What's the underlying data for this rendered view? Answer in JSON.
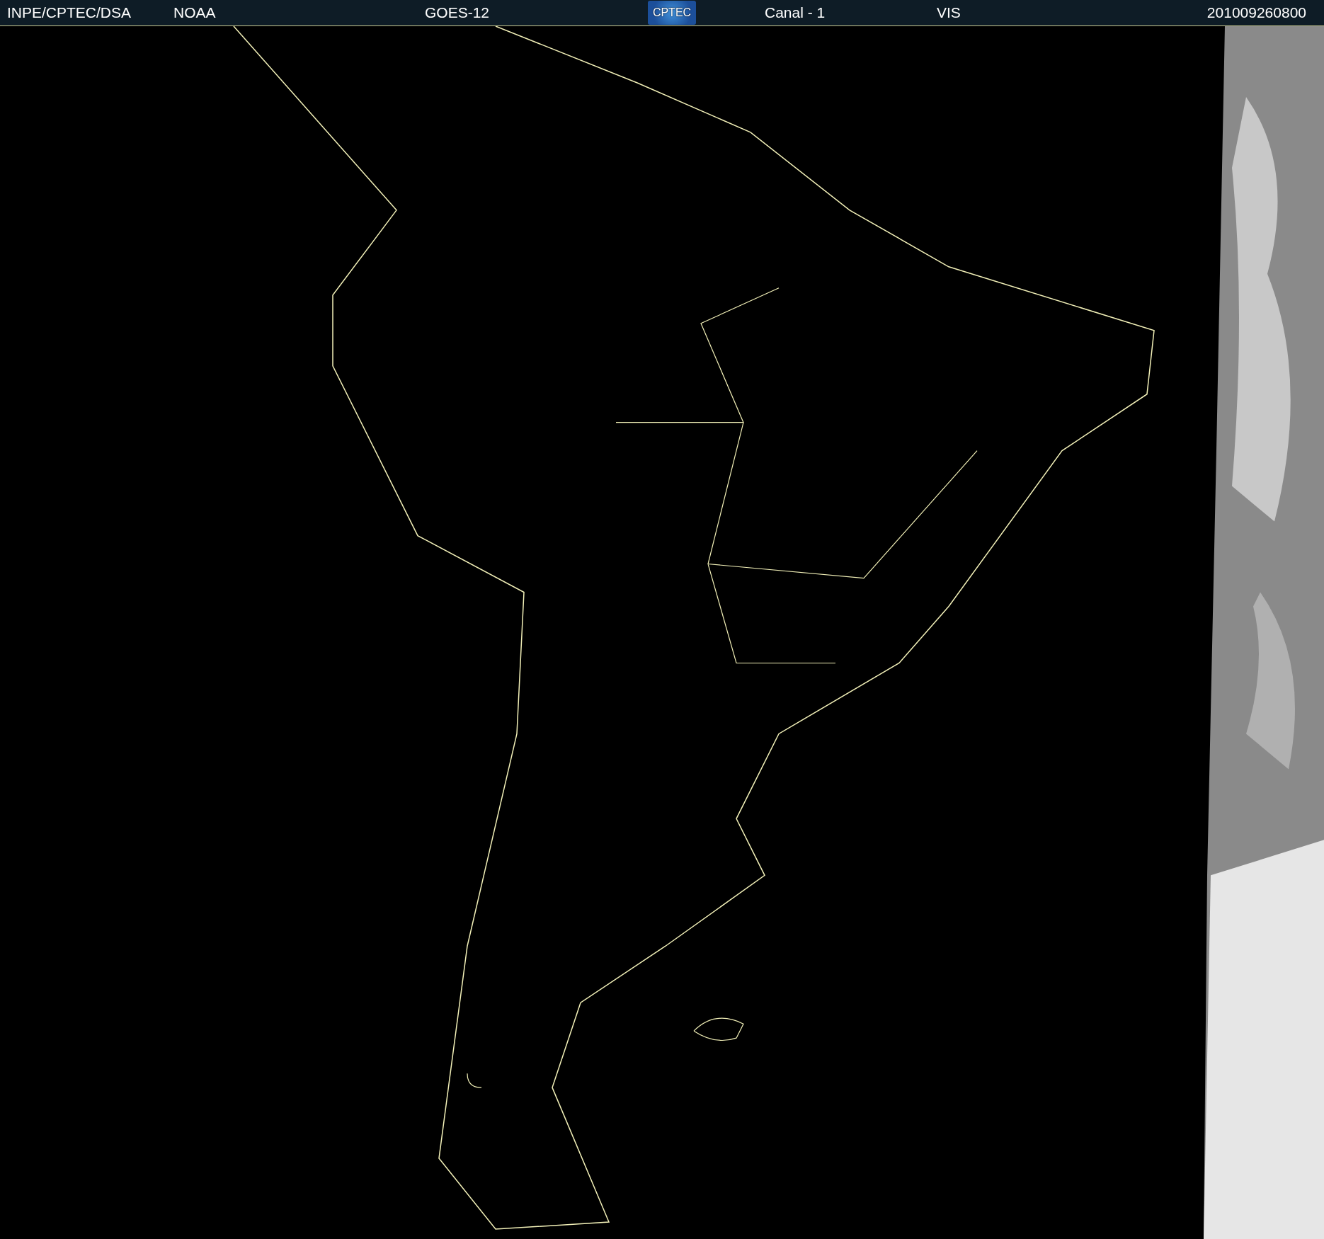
{
  "header": {
    "items": [
      {
        "kind": "text",
        "text": "INPE/CPTEC/DSA"
      },
      {
        "kind": "text",
        "text": "NOAA"
      },
      {
        "kind": "text",
        "text": "GOES-12"
      },
      {
        "kind": "logo",
        "text": "CPTEC"
      },
      {
        "kind": "text",
        "text": "Canal - 1"
      },
      {
        "kind": "text",
        "text": "VIS"
      },
      {
        "kind": "text",
        "text": "201009260800"
      }
    ]
  }
}
